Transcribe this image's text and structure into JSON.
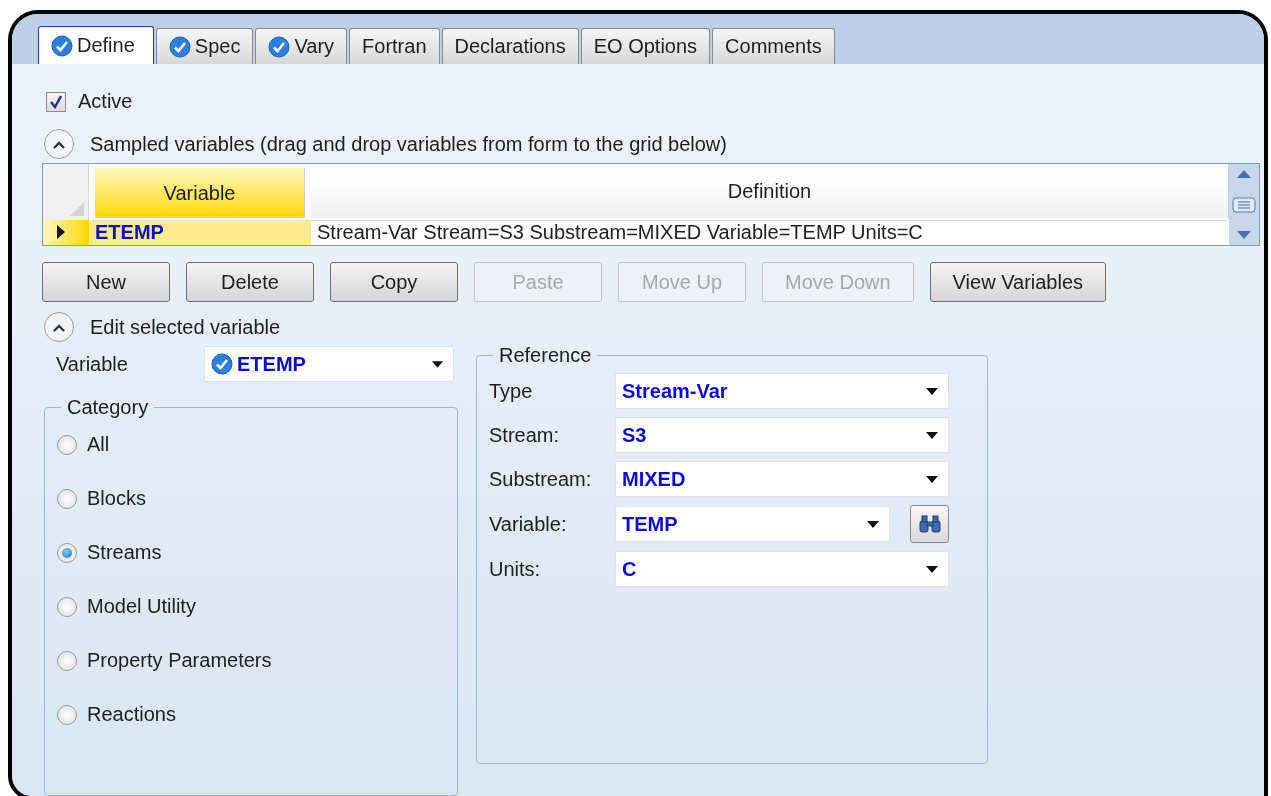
{
  "tabs": [
    {
      "label": "Define",
      "selected": true,
      "complete": true
    },
    {
      "label": "Spec",
      "selected": false,
      "complete": true
    },
    {
      "label": "Vary",
      "selected": false,
      "complete": true
    },
    {
      "label": "Fortran",
      "selected": false,
      "complete": false
    },
    {
      "label": "Declarations",
      "selected": false,
      "complete": false
    },
    {
      "label": "EO Options",
      "selected": false,
      "complete": false
    },
    {
      "label": "Comments",
      "selected": false,
      "complete": false
    }
  ],
  "active": {
    "label": "Active",
    "checked": true
  },
  "sampled_section": {
    "title": "Sampled variables (drag and drop variables from form to the grid below)",
    "expanded": true
  },
  "grid": {
    "columns": [
      {
        "label": "Variable",
        "selected": true
      },
      {
        "label": "Definition",
        "selected": false
      }
    ],
    "rows": [
      {
        "variable": "ETEMP",
        "definition": "Stream-Var Stream=S3 Substream=MIXED Variable=TEMP Units=C",
        "selected": true
      }
    ]
  },
  "buttons": [
    {
      "label": "New",
      "disabled": false
    },
    {
      "label": "Delete",
      "disabled": false
    },
    {
      "label": "Copy",
      "disabled": false
    },
    {
      "label": "Paste",
      "disabled": true
    },
    {
      "label": "Move Up",
      "disabled": true
    },
    {
      "label": "Move Down",
      "disabled": true
    },
    {
      "label": "View Variables",
      "disabled": false
    }
  ],
  "edit_section": {
    "title": "Edit selected variable",
    "expanded": true
  },
  "variable": {
    "label": "Variable",
    "value": "ETEMP",
    "complete": true
  },
  "category": {
    "title": "Category",
    "options": [
      {
        "label": "All",
        "selected": false
      },
      {
        "label": "Blocks",
        "selected": false
      },
      {
        "label": "Streams",
        "selected": true
      },
      {
        "label": "Model Utility",
        "selected": false
      },
      {
        "label": "Property Parameters",
        "selected": false
      },
      {
        "label": "Reactions",
        "selected": false
      }
    ]
  },
  "reference": {
    "title": "Reference",
    "fields": [
      {
        "label": "Type",
        "value": "Stream-Var",
        "kind": "dropdown"
      },
      {
        "label": "Stream:",
        "value": "S3",
        "kind": "dropdown"
      },
      {
        "label": "Substream:",
        "value": "MIXED",
        "kind": "dropdown"
      },
      {
        "label": "Variable:",
        "value": "TEMP",
        "kind": "search"
      },
      {
        "label": "Units:",
        "value": "C",
        "kind": "dropdown"
      }
    ]
  }
}
